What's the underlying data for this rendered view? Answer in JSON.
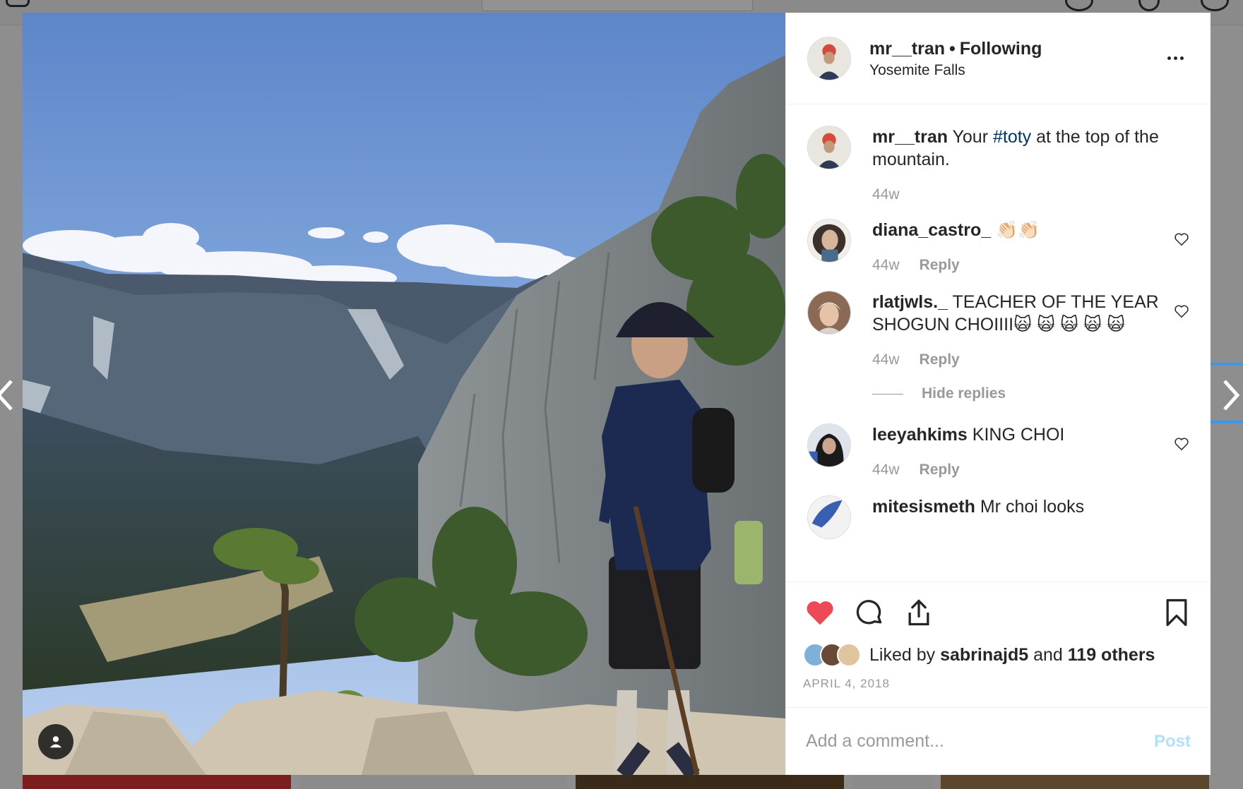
{
  "post": {
    "username": "mr__tran",
    "separator": "•",
    "follow_status": "Following",
    "location": "Yosemite Falls"
  },
  "caption": {
    "username": "mr__tran",
    "text_before": "Your",
    "hashtag": "#toty",
    "text_after": "at the top of the mountain.",
    "time": "44w"
  },
  "comments": [
    {
      "username": "diana_castro_",
      "text": "👏🏻👏🏻",
      "time": "44w",
      "reply_label": "Reply"
    },
    {
      "username": "rlatjwls._",
      "text": "TEACHER OF THE YEAR SHOGUN CHOIIII🙀 🙀 🙀 🙀 🙀",
      "time": "44w",
      "reply_label": "Reply"
    },
    {
      "username": "leeyahkims",
      "text": "KING CHOI",
      "time": "44w",
      "reply_label": "Reply"
    },
    {
      "username": "mitesismeth",
      "text": "Mr choi looks"
    }
  ],
  "hide_replies_label": "Hide replies",
  "likes": {
    "prefix": "Liked by",
    "user": "sabrinajd5",
    "connector": "and",
    "others": "119 others"
  },
  "date": "APRIL 4, 2018",
  "add_comment": {
    "placeholder": "Add a comment...",
    "post_label": "Post"
  },
  "icons": {
    "like": "heart-filled-icon",
    "comment": "comment-bubble-icon",
    "share": "share-icon",
    "save": "bookmark-icon",
    "more": "more-options-icon",
    "tag": "user-tag-icon"
  },
  "colors": {
    "like_red": "#ed4956",
    "hashtag_blue": "#003569",
    "post_disabled": "#b2dffc",
    "accent_blue": "#3897f0"
  }
}
